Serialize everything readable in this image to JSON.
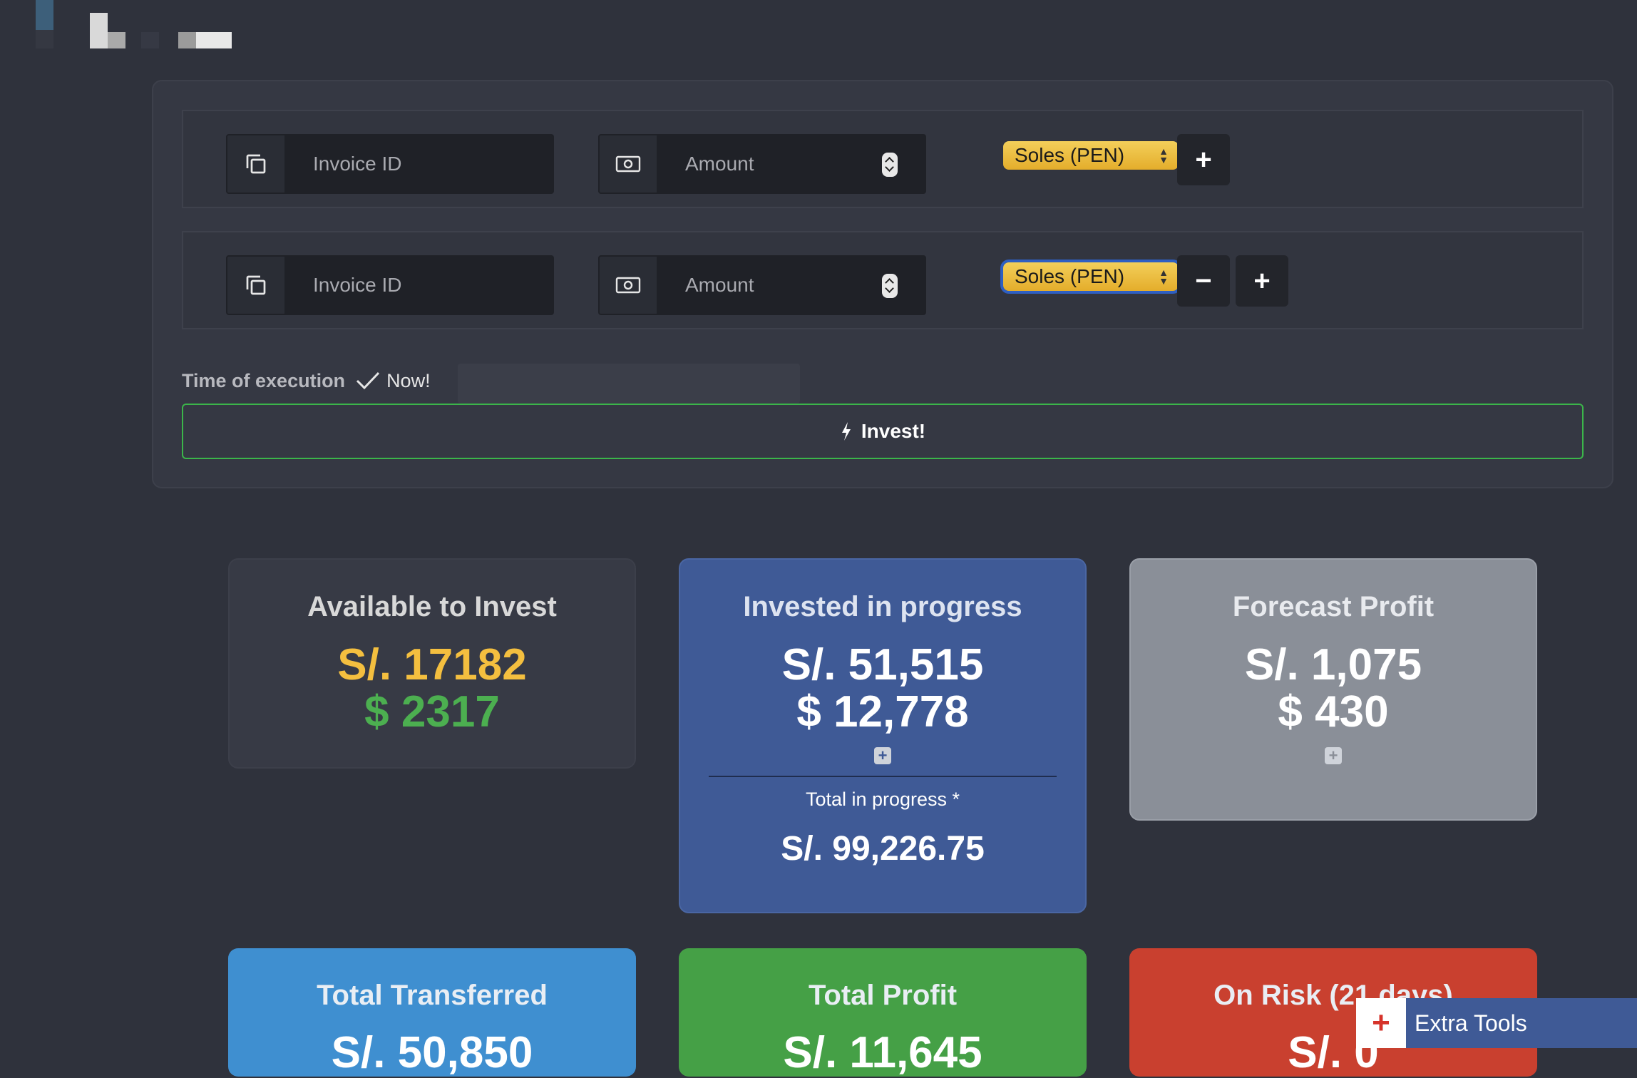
{
  "form": {
    "rows": [
      {
        "invoice_placeholder": "Invoice ID",
        "amount_placeholder": "Amount",
        "currency": "Soles (PEN)"
      },
      {
        "invoice_placeholder": "Invoice ID",
        "amount_placeholder": "Amount",
        "currency": "Soles (PEN)"
      }
    ],
    "plus_label": "+",
    "minus_label": "−",
    "time_label": "Time of execution",
    "now_label": "Now!",
    "invest_label": "Invest!"
  },
  "cards": {
    "available": {
      "title": "Available to Invest",
      "pen": "S/. 17182",
      "usd": "$ 2317"
    },
    "invested": {
      "title": "Invested in progress",
      "pen": "S/. 51,515",
      "usd": "$ 12,778",
      "total_label": "Total in progress *",
      "total_value": "S/. 99,226.75"
    },
    "forecast": {
      "title": "Forecast Profit",
      "pen": "S/. 1,075",
      "usd": "$ 430"
    },
    "transferred": {
      "title": "Total Transferred",
      "pen": "S/. 50,850"
    },
    "profit": {
      "title": "Total Profit",
      "pen": "S/. 11,645"
    },
    "risk": {
      "title": "On Risk (21 days)",
      "pen": "S/. 0"
    }
  },
  "extra_tools": {
    "label": "Extra Tools"
  },
  "colors": {
    "background": "#2f323c",
    "available_pen": "#f4bf3f",
    "available_usd": "#4caf50",
    "invested_card": "#3f5a96",
    "forecast_card": "#8a8f98",
    "transferred_card": "#3f8fd0",
    "profit_card": "#45a046",
    "risk_card": "#c9402f",
    "invest_border": "#3bb54a",
    "select": "#e4ad2b"
  }
}
